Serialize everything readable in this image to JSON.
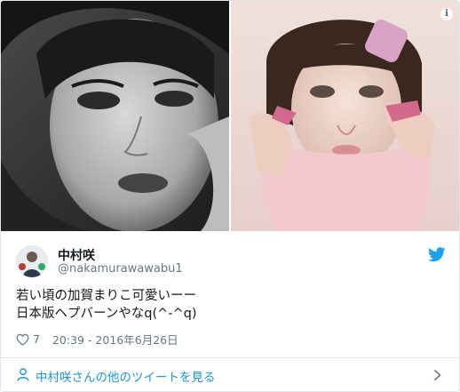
{
  "tweet": {
    "author_name": "中村咲",
    "author_handle": "@nakamurawawabu1",
    "text_line1": "若い頃の加賀まりこ可愛いーー",
    "text_line2": "日本版ヘプバーンやなq(^-^q)",
    "likes": "7",
    "timestamp": "20:39 - 2016年6月26日",
    "footer_link": "中村咲さんの他のツイートを見る"
  },
  "icons": {
    "info": "info-icon",
    "bird": "twitter-bird-icon",
    "heart": "heart-icon",
    "person": "person-icon",
    "chevron": "chevron-right-icon"
  },
  "colors": {
    "brand": "#1da1f2",
    "link": "#1b95e0",
    "secondary_text": "#657786",
    "border": "#e1e8ed"
  }
}
